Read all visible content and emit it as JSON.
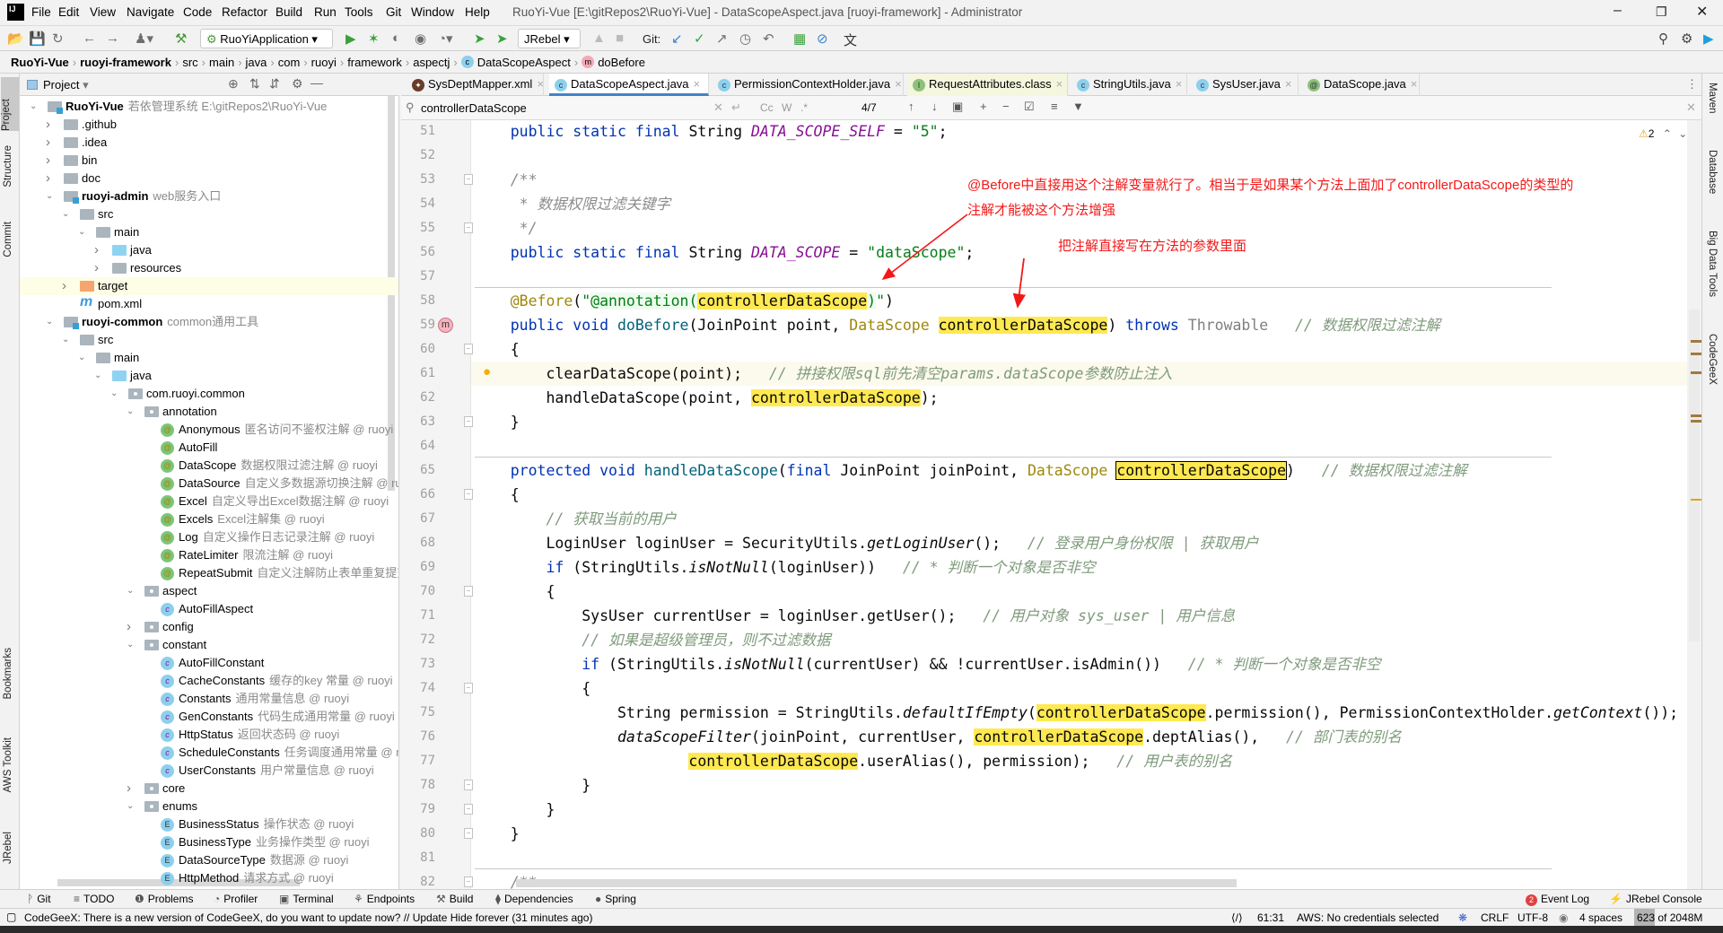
{
  "window": {
    "title": "RuoYi-Vue [E:\\gitRepos2\\RuoYi-Vue] - DataScopeAspect.java [ruoyi-framework] - Administrator",
    "logo": "IJ",
    "menu": [
      "File",
      "Edit",
      "View",
      "Navigate",
      "Code",
      "Refactor",
      "Build",
      "Run",
      "Tools",
      "Git",
      "Window",
      "Help"
    ]
  },
  "toolbar": {
    "run_config": "RuoYiApplication",
    "jrebel": "JRebel",
    "git_label": "Git:"
  },
  "breadcrumb": [
    "RuoYi-Vue",
    "ruoyi-framework",
    "src",
    "main",
    "java",
    "com",
    "ruoyi",
    "framework",
    "aspectj",
    "DataScopeAspect",
    "doBefore"
  ],
  "left_stripe": [
    "Project",
    "Structure",
    "Commit",
    "Bookmarks",
    "AWS Toolkit",
    "JRebel"
  ],
  "right_stripe": [
    "Maven",
    "Database",
    "Big Data Tools",
    "CodeGeeX"
  ],
  "project": {
    "title": "Project",
    "tree": [
      [
        0,
        "open",
        "mod",
        "RuoYi-Vue",
        true,
        "若依管理系统  E:\\gitRepos2\\RuoYi-Vue"
      ],
      [
        1,
        "closed",
        "fold",
        ".github",
        false,
        ""
      ],
      [
        1,
        "closed",
        "fold",
        ".idea",
        false,
        ""
      ],
      [
        1,
        "closed",
        "fold",
        "bin",
        false,
        ""
      ],
      [
        1,
        "closed",
        "fold",
        "doc",
        false,
        ""
      ],
      [
        1,
        "open",
        "mod",
        "ruoyi-admin",
        true,
        "web服务入口"
      ],
      [
        2,
        "open",
        "fold",
        "src",
        false,
        ""
      ],
      [
        3,
        "open",
        "fold",
        "main",
        false,
        ""
      ],
      [
        4,
        "closed",
        "src",
        "java",
        false,
        ""
      ],
      [
        4,
        "closed",
        "fold",
        "resources",
        false,
        ""
      ],
      [
        2,
        "closed",
        "tgt",
        "target",
        false,
        ""
      ],
      [
        2,
        "",
        "mvn",
        "pom.xml",
        false,
        ""
      ],
      [
        1,
        "open",
        "mod",
        "ruoyi-common",
        true,
        "common通用工具"
      ],
      [
        2,
        "open",
        "fold",
        "src",
        false,
        ""
      ],
      [
        3,
        "open",
        "fold",
        "main",
        false,
        ""
      ],
      [
        4,
        "open",
        "src",
        "java",
        false,
        ""
      ],
      [
        5,
        "open",
        "pkg",
        "com.ruoyi.common",
        false,
        ""
      ],
      [
        6,
        "open",
        "pkg",
        "annotation",
        false,
        ""
      ],
      [
        7,
        "",
        "a",
        "Anonymous",
        false,
        "匿名访问不鉴权注解 @ ruoyi"
      ],
      [
        7,
        "",
        "a",
        "AutoFill",
        false,
        ""
      ],
      [
        7,
        "",
        "a",
        "DataScope",
        false,
        "数据权限过滤注解 @ ruoyi"
      ],
      [
        7,
        "",
        "a",
        "DataSource",
        false,
        "自定义多数据源切换注解 @ ruoyi"
      ],
      [
        7,
        "",
        "a",
        "Excel",
        false,
        "自定义导出Excel数据注解 @ ruoyi"
      ],
      [
        7,
        "",
        "a",
        "Excels",
        false,
        "Excel注解集 @ ruoyi"
      ],
      [
        7,
        "",
        "a",
        "Log",
        false,
        "自定义操作日志记录注解 @ ruoyi"
      ],
      [
        7,
        "",
        "a",
        "RateLimiter",
        false,
        "限流注解 @ ruoyi"
      ],
      [
        7,
        "",
        "a",
        "RepeatSubmit",
        false,
        "自定义注解防止表单重复提交 @ ruoyi"
      ],
      [
        6,
        "open",
        "pkg",
        "aspect",
        false,
        ""
      ],
      [
        7,
        "",
        "c",
        "AutoFillAspect",
        false,
        ""
      ],
      [
        6,
        "closed",
        "pkg",
        "config",
        false,
        ""
      ],
      [
        6,
        "open",
        "pkg",
        "constant",
        false,
        ""
      ],
      [
        7,
        "",
        "c",
        "AutoFillConstant",
        false,
        ""
      ],
      [
        7,
        "",
        "c",
        "CacheConstants",
        false,
        "缓存的key 常量 @ ruoyi"
      ],
      [
        7,
        "",
        "c",
        "Constants",
        false,
        "通用常量信息 @ ruoyi"
      ],
      [
        7,
        "",
        "c",
        "GenConstants",
        false,
        "代码生成通用常量 @ ruoyi"
      ],
      [
        7,
        "",
        "c",
        "HttpStatus",
        false,
        "返回状态码 @ ruoyi"
      ],
      [
        7,
        "",
        "c",
        "ScheduleConstants",
        false,
        "任务调度通用常量 @ ruoyi"
      ],
      [
        7,
        "",
        "c",
        "UserConstants",
        false,
        "用户常量信息 @ ruoyi"
      ],
      [
        6,
        "closed",
        "pkg",
        "core",
        false,
        ""
      ],
      [
        6,
        "open",
        "pkg",
        "enums",
        false,
        ""
      ],
      [
        7,
        "",
        "e",
        "BusinessStatus",
        false,
        "操作状态 @ ruoyi"
      ],
      [
        7,
        "",
        "e",
        "BusinessType",
        false,
        "业务操作类型 @ ruoyi"
      ],
      [
        7,
        "",
        "e",
        "DataSourceType",
        false,
        "数据源 @ ruoyi"
      ],
      [
        7,
        "",
        "e",
        "HttpMethod",
        false,
        "请求方式 @ ruoyi"
      ]
    ]
  },
  "tabs": [
    {
      "label": "SysDeptMapper.xml",
      "icon": "xml"
    },
    {
      "label": "DataScopeAspect.java",
      "icon": "c",
      "active": true
    },
    {
      "label": "PermissionContextHolder.java",
      "icon": "c"
    },
    {
      "label": "RequestAttributes.class",
      "icon": "i"
    },
    {
      "label": "StringUtils.java",
      "icon": "c"
    },
    {
      "label": "SysUser.java",
      "icon": "c"
    },
    {
      "label": "DataScope.java",
      "icon": "@"
    }
  ],
  "search": {
    "value": "controllerDataScope",
    "match_count": "4/7",
    "case_label": "Cc",
    "word_label": "W",
    "regex_label": ".*"
  },
  "inspections": {
    "warnings": "2"
  },
  "editor": {
    "first_line": 51,
    "current_line": 61,
    "lines": [
      [
        [
          "p",
          "    "
        ],
        [
          "k",
          "public static final "
        ],
        [
          "p",
          "String "
        ],
        [
          "c",
          "DATA_SCOPE_SELF"
        ],
        [
          "p",
          " = "
        ],
        [
          "s",
          "\"5\""
        ],
        [
          "p",
          ";"
        ]
      ],
      [],
      [
        [
          "d",
          "    /**"
        ]
      ],
      [
        [
          "d",
          "     * 数据权限过滤关键字"
        ]
      ],
      [
        [
          "d",
          "     */"
        ]
      ],
      [
        [
          "p",
          "    "
        ],
        [
          "k",
          "public static final "
        ],
        [
          "p",
          "String "
        ],
        [
          "c",
          "DATA_SCOPE"
        ],
        [
          "p",
          " = "
        ],
        [
          "s",
          "\"dataScope\""
        ],
        [
          "p",
          ";"
        ]
      ],
      [],
      [
        [
          "p",
          "    "
        ],
        [
          "a",
          "@Before"
        ],
        [
          "p",
          "("
        ],
        [
          "s",
          "\""
        ],
        [
          "j",
          "@annotation("
        ],
        [
          "h",
          "controllerDataScope"
        ],
        [
          "j",
          ")"
        ],
        [
          "s",
          "\""
        ],
        [
          "p",
          ")"
        ]
      ],
      [
        [
          "p",
          "    "
        ],
        [
          "k",
          "public void "
        ],
        [
          "f",
          "doBefore"
        ],
        [
          "p",
          "(JoinPoint point, "
        ],
        [
          "t",
          "DataScope "
        ],
        [
          "h",
          "controllerDataScope"
        ],
        [
          "p",
          ") "
        ],
        [
          "k",
          "throws "
        ],
        [
          "g",
          "Throwable"
        ],
        [
          "p",
          "   "
        ],
        [
          "m",
          "// 数据权限过滤注解"
        ]
      ],
      [
        [
          "p",
          "    {"
        ]
      ],
      [
        [
          "p",
          "        clearDataScope(point);   "
        ],
        [
          "m",
          "// 拼接权限sql前先清空params.dataScope参数防止注入"
        ]
      ],
      [
        [
          "p",
          "        handleDataScope(point, "
        ],
        [
          "h",
          "controllerDataScope"
        ],
        [
          "p",
          ");"
        ]
      ],
      [
        [
          "p",
          "    }"
        ]
      ],
      [],
      [
        [
          "p",
          "    "
        ],
        [
          "k",
          "protected void "
        ],
        [
          "f",
          "handleDataScope"
        ],
        [
          "p",
          "("
        ],
        [
          "k",
          "final "
        ],
        [
          "p",
          "JoinPoint joinPoint, "
        ],
        [
          "t",
          "DataScope "
        ],
        [
          "H",
          "controllerDataScope"
        ],
        [
          "p",
          ")   "
        ],
        [
          "m",
          "// 数据权限过滤注解"
        ]
      ],
      [
        [
          "p",
          "    {"
        ]
      ],
      [
        [
          "m",
          "        // 获取当前的用户"
        ]
      ],
      [
        [
          "p",
          "        LoginUser loginUser = SecurityUtils."
        ],
        [
          "i",
          "getLoginUser"
        ],
        [
          "p",
          "();   "
        ],
        [
          "m",
          "// 登录用户身份权限 | 获取用户"
        ]
      ],
      [
        [
          "p",
          "        "
        ],
        [
          "k",
          "if "
        ],
        [
          "p",
          "(StringUtils."
        ],
        [
          "i",
          "isNotNull"
        ],
        [
          "p",
          "(loginUser))   "
        ],
        [
          "m",
          "// * 判断一个对象是否非空"
        ]
      ],
      [
        [
          "p",
          "        {"
        ]
      ],
      [
        [
          "p",
          "            SysUser currentUser = loginUser.getUser();   "
        ],
        [
          "m",
          "// 用户对象 sys_user | 用户信息"
        ]
      ],
      [
        [
          "m",
          "            // 如果是超级管理员，则不过滤数据"
        ]
      ],
      [
        [
          "p",
          "            "
        ],
        [
          "k",
          "if "
        ],
        [
          "p",
          "(StringUtils."
        ],
        [
          "i",
          "isNotNull"
        ],
        [
          "p",
          "(currentUser) && !currentUser.isAdmin())   "
        ],
        [
          "m",
          "// * 判断一个对象是否非空"
        ]
      ],
      [
        [
          "p",
          "            {"
        ]
      ],
      [
        [
          "p",
          "                String permission = StringUtils."
        ],
        [
          "i",
          "defaultIfEmpty"
        ],
        [
          "p",
          "("
        ],
        [
          "h",
          "controllerDataScope"
        ],
        [
          "p",
          ".permission(), PermissionContextHolder."
        ],
        [
          "i",
          "getContext"
        ],
        [
          "p",
          "());"
        ]
      ],
      [
        [
          "p",
          "                "
        ],
        [
          "i",
          "dataScopeFilter"
        ],
        [
          "p",
          "(joinPoint, currentUser, "
        ],
        [
          "h",
          "controllerDataScope"
        ],
        [
          "p",
          ".deptAlias(),   "
        ],
        [
          "m",
          "// 部门表的别名"
        ]
      ],
      [
        [
          "p",
          "                        "
        ],
        [
          "h",
          "controllerDataScope"
        ],
        [
          "p",
          ".userAlias(), permission);   "
        ],
        [
          "m",
          "// 用户表的别名"
        ]
      ],
      [
        [
          "p",
          "            }"
        ]
      ],
      [
        [
          "p",
          "        }"
        ]
      ],
      [
        [
          "p",
          "    }"
        ]
      ],
      [],
      [
        [
          "d",
          "    /**"
        ]
      ]
    ]
  },
  "annotations": {
    "note1_line1": "@Before中直接用这个注解变量就行了。相当于是如果某个方法上面加了controllerDataScope的类型的",
    "note1_line2": "注解才能被这个方法增强",
    "note2": "把注解直接写在方法的参数里面",
    "color": "#f31818"
  },
  "bottom_tools": [
    "Git",
    "TODO",
    "Problems",
    "Profiler",
    "Terminal",
    "Endpoints",
    "Build",
    "Dependencies",
    "Spring"
  ],
  "bottom_right": {
    "event_log": "Event Log",
    "event_count": "2",
    "jrebel_console": "JRebel Console"
  },
  "status": {
    "message": "CodeGeeX: There is a new version of CodeGeeX, do you want to update now? // Update   Hide forever (31 minutes ago)",
    "position": "61:31",
    "aws": "AWS: No credentials selected",
    "line_sep": "CRLF",
    "encoding": "UTF-8",
    "indent": "4 spaces",
    "memory": "623 of 2048M"
  },
  "colors": {
    "accent": "#4083c9",
    "match_highlight": "#ffe952",
    "keyword": "#0033b3"
  }
}
